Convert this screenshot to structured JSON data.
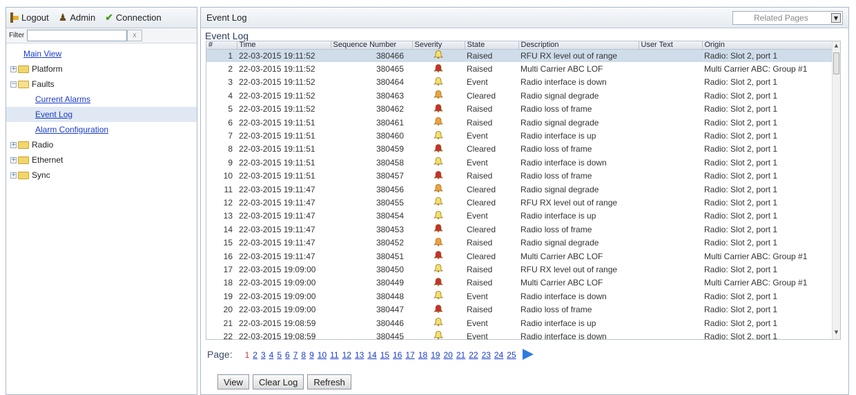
{
  "topbar": {
    "logout": "Logout",
    "admin": "Admin",
    "connection": "Connection"
  },
  "filter": {
    "label": "Filter",
    "value": "",
    "clear": "x"
  },
  "tree": {
    "main_view": "Main View",
    "platform": "Platform",
    "faults": "Faults",
    "current_alarms": "Current Alarms",
    "event_log": "Event Log",
    "alarm_config": "Alarm Configuration",
    "radio": "Radio",
    "ethernet": "Ethernet",
    "sync": "Sync"
  },
  "header": {
    "title": "Event Log",
    "related": "Related Pages"
  },
  "section_title": "Event Log",
  "columns": [
    "#",
    "Time",
    "Sequence Number",
    "Severity",
    "State",
    "Description",
    "User Text",
    "Origin"
  ],
  "severity_colors": {
    "major": "#c8302e",
    "minor": "#f2a13a",
    "warning": "#f4e064"
  },
  "rows": [
    {
      "n": "1",
      "time": "22-03-2015 19:11:52",
      "seq": "380466",
      "sev": "warning",
      "state": "Raised",
      "desc": "RFU RX level out of range",
      "user": "",
      "origin": "Radio: Slot 2, port 1"
    },
    {
      "n": "2",
      "time": "22-03-2015 19:11:52",
      "seq": "380465",
      "sev": "major",
      "state": "Raised",
      "desc": "Multi Carrier ABC LOF",
      "user": "",
      "origin": "Multi Carrier ABC: Group #1"
    },
    {
      "n": "3",
      "time": "22-03-2015 19:11:52",
      "seq": "380464",
      "sev": "warning",
      "state": "Event",
      "desc": "Radio interface is down",
      "user": "",
      "origin": "Radio: Slot 2, port 1"
    },
    {
      "n": "4",
      "time": "22-03-2015 19:11:52",
      "seq": "380463",
      "sev": "minor",
      "state": "Cleared",
      "desc": "Radio signal degrade",
      "user": "",
      "origin": "Radio: Slot 2, port 1"
    },
    {
      "n": "5",
      "time": "22-03-2015 19:11:52",
      "seq": "380462",
      "sev": "major",
      "state": "Raised",
      "desc": "Radio loss of frame",
      "user": "",
      "origin": "Radio: Slot 2, port 1"
    },
    {
      "n": "6",
      "time": "22-03-2015 19:11:51",
      "seq": "380461",
      "sev": "minor",
      "state": "Raised",
      "desc": "Radio signal degrade",
      "user": "",
      "origin": "Radio: Slot 2, port 1"
    },
    {
      "n": "7",
      "time": "22-03-2015 19:11:51",
      "seq": "380460",
      "sev": "warning",
      "state": "Event",
      "desc": "Radio interface is up",
      "user": "",
      "origin": "Radio: Slot 2, port 1"
    },
    {
      "n": "8",
      "time": "22-03-2015 19:11:51",
      "seq": "380459",
      "sev": "major",
      "state": "Cleared",
      "desc": "Radio loss of frame",
      "user": "",
      "origin": "Radio: Slot 2, port 1"
    },
    {
      "n": "9",
      "time": "22-03-2015 19:11:51",
      "seq": "380458",
      "sev": "warning",
      "state": "Event",
      "desc": "Radio interface is down",
      "user": "",
      "origin": "Radio: Slot 2, port 1"
    },
    {
      "n": "10",
      "time": "22-03-2015 19:11:51",
      "seq": "380457",
      "sev": "major",
      "state": "Raised",
      "desc": "Radio loss of frame",
      "user": "",
      "origin": "Radio: Slot 2, port 1"
    },
    {
      "n": "11",
      "time": "22-03-2015 19:11:47",
      "seq": "380456",
      "sev": "minor",
      "state": "Cleared",
      "desc": "Radio signal degrade",
      "user": "",
      "origin": "Radio: Slot 2, port 1"
    },
    {
      "n": "12",
      "time": "22-03-2015 19:11:47",
      "seq": "380455",
      "sev": "warning",
      "state": "Cleared",
      "desc": "RFU RX level out of range",
      "user": "",
      "origin": "Radio: Slot 2, port 1"
    },
    {
      "n": "13",
      "time": "22-03-2015 19:11:47",
      "seq": "380454",
      "sev": "warning",
      "state": "Event",
      "desc": "Radio interface is up",
      "user": "",
      "origin": "Radio: Slot 2, port 1"
    },
    {
      "n": "14",
      "time": "22-03-2015 19:11:47",
      "seq": "380453",
      "sev": "major",
      "state": "Cleared",
      "desc": "Radio loss of frame",
      "user": "",
      "origin": "Radio: Slot 2, port 1"
    },
    {
      "n": "15",
      "time": "22-03-2015 19:11:47",
      "seq": "380452",
      "sev": "minor",
      "state": "Raised",
      "desc": "Radio signal degrade",
      "user": "",
      "origin": "Radio: Slot 2, port 1"
    },
    {
      "n": "16",
      "time": "22-03-2015 19:11:47",
      "seq": "380451",
      "sev": "major",
      "state": "Cleared",
      "desc": "Multi Carrier ABC LOF",
      "user": "",
      "origin": "Multi Carrier ABC: Group #1"
    },
    {
      "n": "17",
      "time": "22-03-2015 19:09:00",
      "seq": "380450",
      "sev": "warning",
      "state": "Raised",
      "desc": "RFU RX level out of range",
      "user": "",
      "origin": "Radio: Slot 2, port 1"
    },
    {
      "n": "18",
      "time": "22-03-2015 19:09:00",
      "seq": "380449",
      "sev": "major",
      "state": "Raised",
      "desc": "Multi Carrier ABC LOF",
      "user": "",
      "origin": "Multi Carrier ABC: Group #1"
    },
    {
      "n": "19",
      "time": "22-03-2015 19:09:00",
      "seq": "380448",
      "sev": "warning",
      "state": "Event",
      "desc": "Radio interface is down",
      "user": "",
      "origin": "Radio: Slot 2, port 1"
    },
    {
      "n": "20",
      "time": "22-03-2015 19:09:00",
      "seq": "380447",
      "sev": "major",
      "state": "Raised",
      "desc": "Radio loss of frame",
      "user": "",
      "origin": "Radio: Slot 2, port 1"
    },
    {
      "n": "21",
      "time": "22-03-2015 19:08:59",
      "seq": "380446",
      "sev": "warning",
      "state": "Event",
      "desc": "Radio interface is up",
      "user": "",
      "origin": "Radio: Slot 2, port 1"
    },
    {
      "n": "22",
      "time": "22-03-2015 19:08:59",
      "seq": "380445",
      "sev": "warning",
      "state": "Event",
      "desc": "Radio interface is down",
      "user": "",
      "origin": "Radio: Slot 2, port 1"
    }
  ],
  "pager": {
    "label": "Page:",
    "pages": [
      "1",
      "2",
      "3",
      "4",
      "5",
      "6",
      "7",
      "8",
      "9",
      "10",
      "11",
      "12",
      "13",
      "14",
      "15",
      "16",
      "17",
      "18",
      "19",
      "20",
      "21",
      "22",
      "23",
      "24",
      "25"
    ],
    "current": "1"
  },
  "buttons": {
    "view": "View",
    "clear_log": "Clear Log",
    "refresh": "Refresh"
  }
}
